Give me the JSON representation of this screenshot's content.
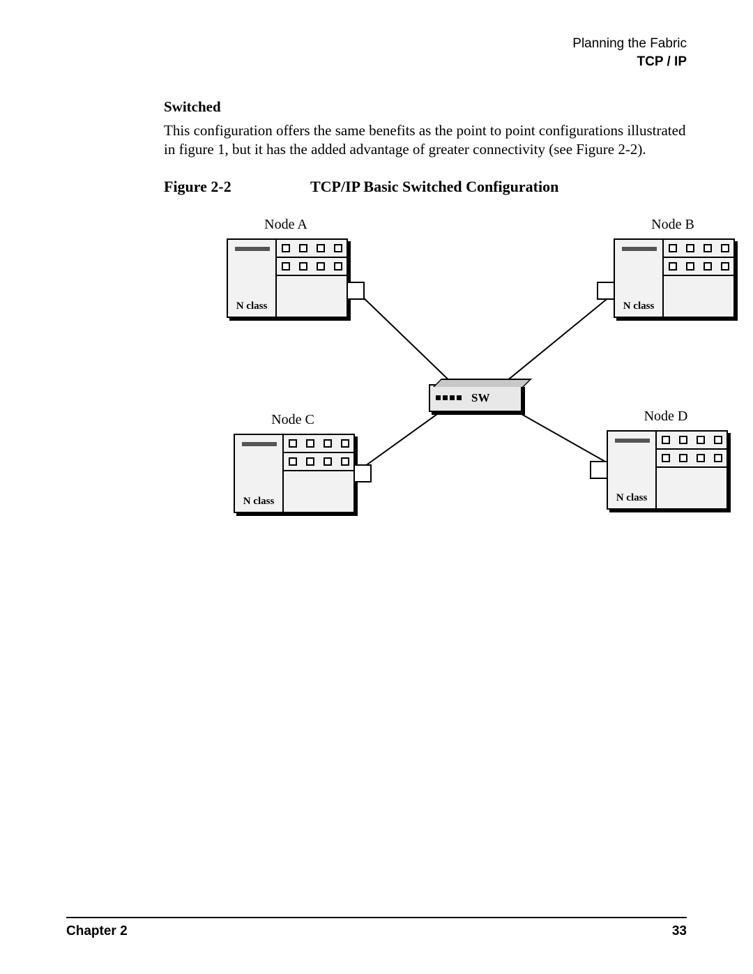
{
  "header": {
    "line1": "Planning the Fabric",
    "line2": "TCP / IP"
  },
  "section": {
    "heading": "Switched",
    "paragraph": "This configuration offers the same benefits as the point to point configurations illustrated in figure 1, but it has the added advantage of greater connectivity (see Figure 2-2)."
  },
  "figure": {
    "label": "Figure 2-2",
    "title": "TCP/IP Basic Switched Configuration",
    "nodes": {
      "a": {
        "title": "Node A",
        "class_label": "N class"
      },
      "b": {
        "title": "Node B",
        "class_label": "N class"
      },
      "c": {
        "title": "Node C",
        "class_label": "N class"
      },
      "d": {
        "title": "Node D",
        "class_label": "N class"
      }
    },
    "switch_label": "SW"
  },
  "footer": {
    "chapter": "Chapter 2",
    "page": "33"
  }
}
